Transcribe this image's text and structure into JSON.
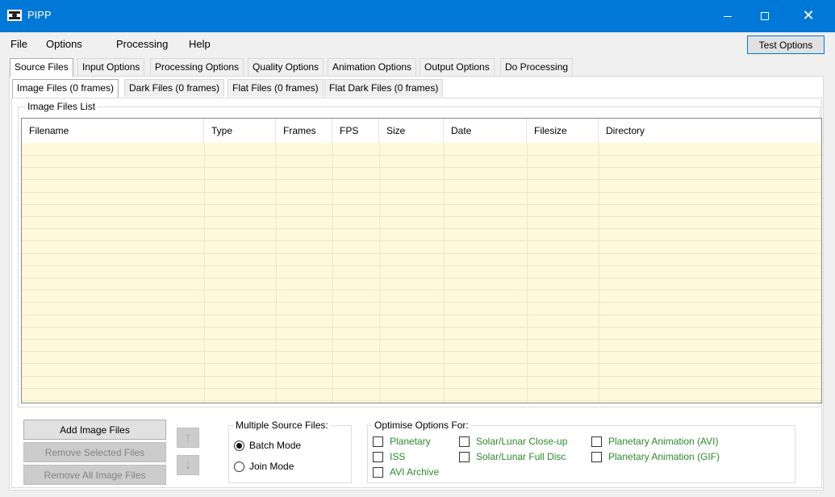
{
  "window": {
    "title": "PIPP"
  },
  "menu": {
    "file": "File",
    "options": "Options",
    "processing": "Processing",
    "help": "Help",
    "test_options": "Test Options"
  },
  "main_tabs": [
    "Source Files",
    "Input Options",
    "Processing Options",
    "Quality Options",
    "Animation Options",
    "Output Options",
    "Do Processing"
  ],
  "sub_tabs": [
    "Image Files (0 frames)",
    "Dark Files (0 frames)",
    "Flat Files (0 frames)",
    "Flat Dark Files (0 frames)"
  ],
  "file_list": {
    "group_title": "Image Files List",
    "columns": [
      "Filename",
      "Type",
      "Frames",
      "FPS",
      "Size",
      "Date",
      "Filesize",
      "Directory"
    ],
    "rows": []
  },
  "buttons": {
    "add": "Add Image Files",
    "remove_selected": "Remove Selected Files",
    "remove_all": "Remove All Image Files",
    "move_up": "↑",
    "move_down": "↓"
  },
  "multiple_source": {
    "title": "Multiple Source Files:",
    "batch": "Batch Mode",
    "join": "Join Mode",
    "selected": "batch"
  },
  "optimise": {
    "title": "Optimise Options For:",
    "options": [
      "Planetary",
      "ISS",
      "AVI Archive",
      "Solar/Lunar Close-up",
      "Solar/Lunar Full Disc",
      "Planetary Animation (AVI)",
      "Planetary Animation (GIF)"
    ]
  },
  "colors": {
    "titlebar": "#0078d7",
    "list_bg": "#fff8dc",
    "option_text": "#2b8a2b"
  }
}
